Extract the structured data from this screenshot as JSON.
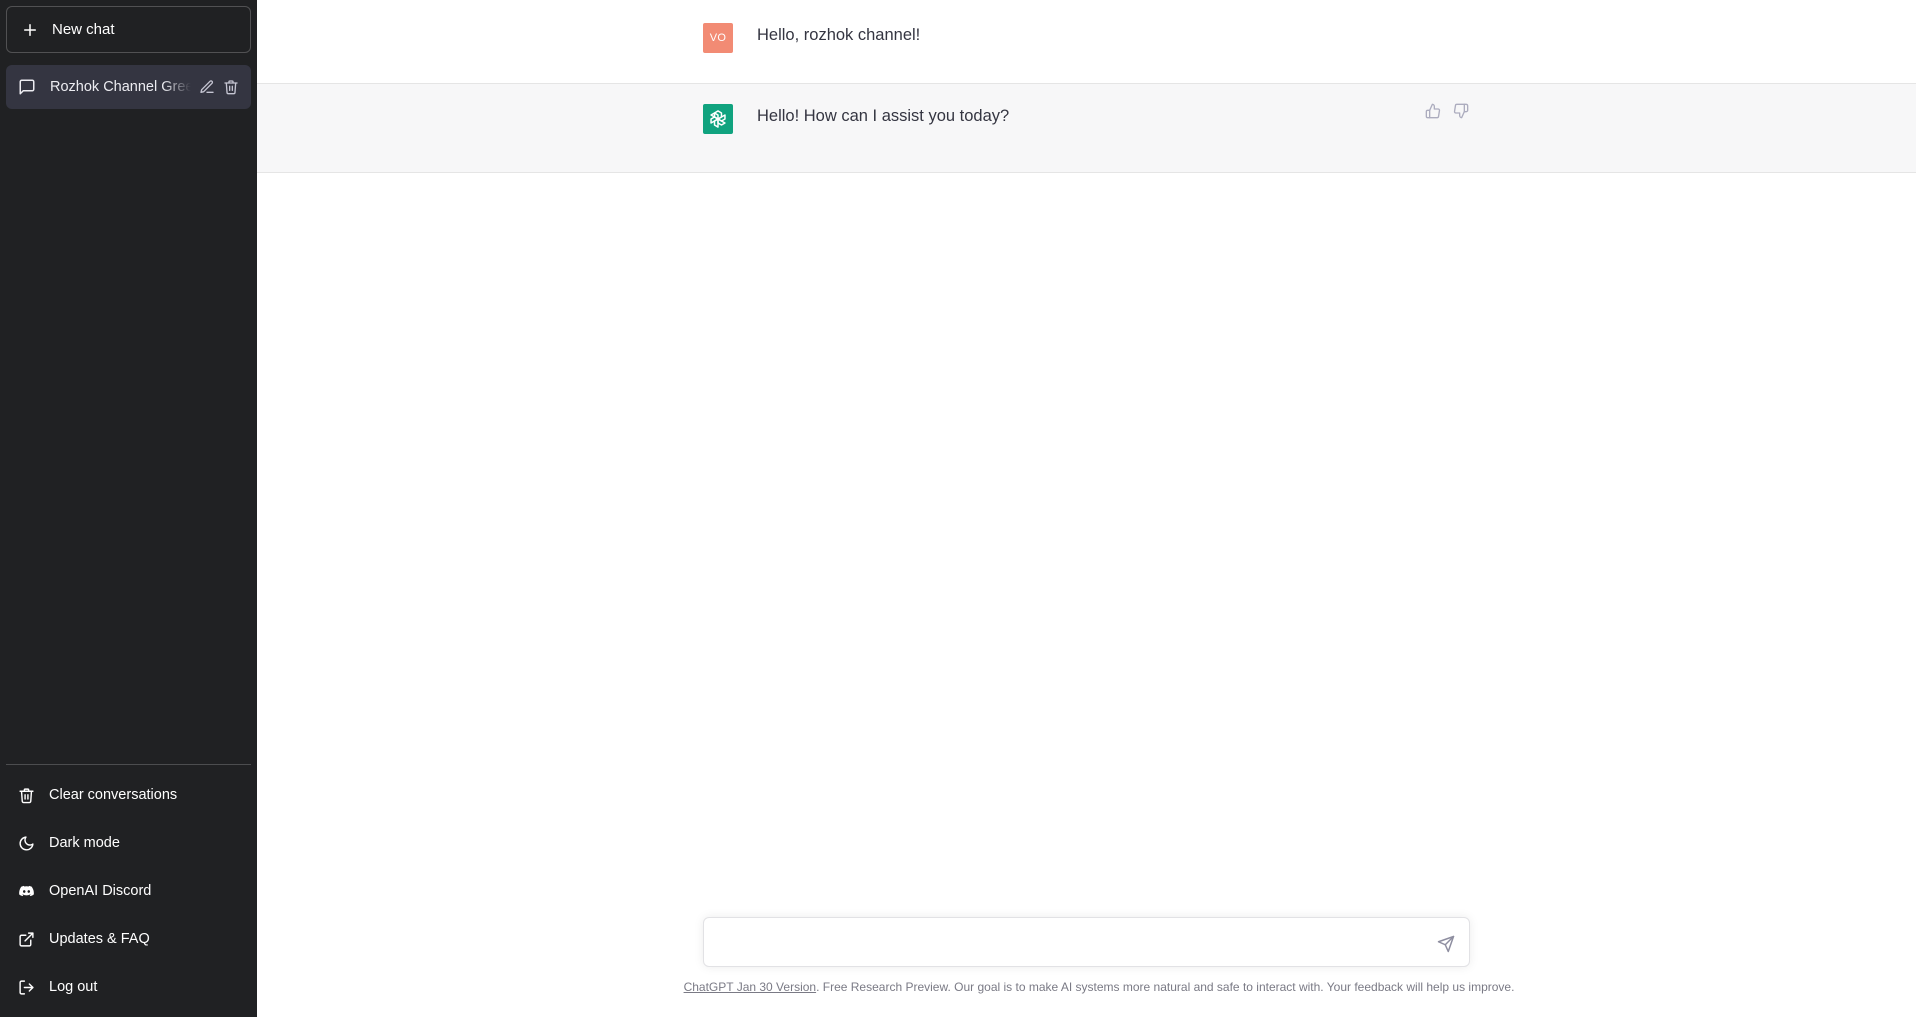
{
  "sidebar": {
    "new_chat_label": "New chat",
    "conversations": [
      {
        "title": "Rozhok Channel Greeting"
      }
    ],
    "menu": [
      {
        "label": "Clear conversations",
        "icon": "trash-icon"
      },
      {
        "label": "Dark mode",
        "icon": "moon-icon"
      },
      {
        "label": "OpenAI Discord",
        "icon": "discord-icon"
      },
      {
        "label": "Updates & FAQ",
        "icon": "external-link-icon"
      },
      {
        "label": "Log out",
        "icon": "logout-icon"
      }
    ]
  },
  "thread": {
    "messages": [
      {
        "role": "user",
        "avatar_text": "VO",
        "text": "Hello, rozhok channel!"
      },
      {
        "role": "assistant",
        "avatar": "openai-logo-icon",
        "text": "Hello! How can I assist you today?"
      }
    ]
  },
  "composer": {
    "value": "",
    "placeholder": ""
  },
  "footer": {
    "version_link": "ChatGPT Jan 30 Version",
    "note": ". Free Research Preview. Our goal is to make AI systems more natural and safe to interact with. Your feedback will help us improve."
  },
  "colors": {
    "sidebar_bg": "#202123",
    "active_item_bg": "#343541",
    "user_avatar": "#f28b74",
    "assistant_avatar": "#10a37f",
    "assistant_row_bg": "#f7f7f8"
  }
}
